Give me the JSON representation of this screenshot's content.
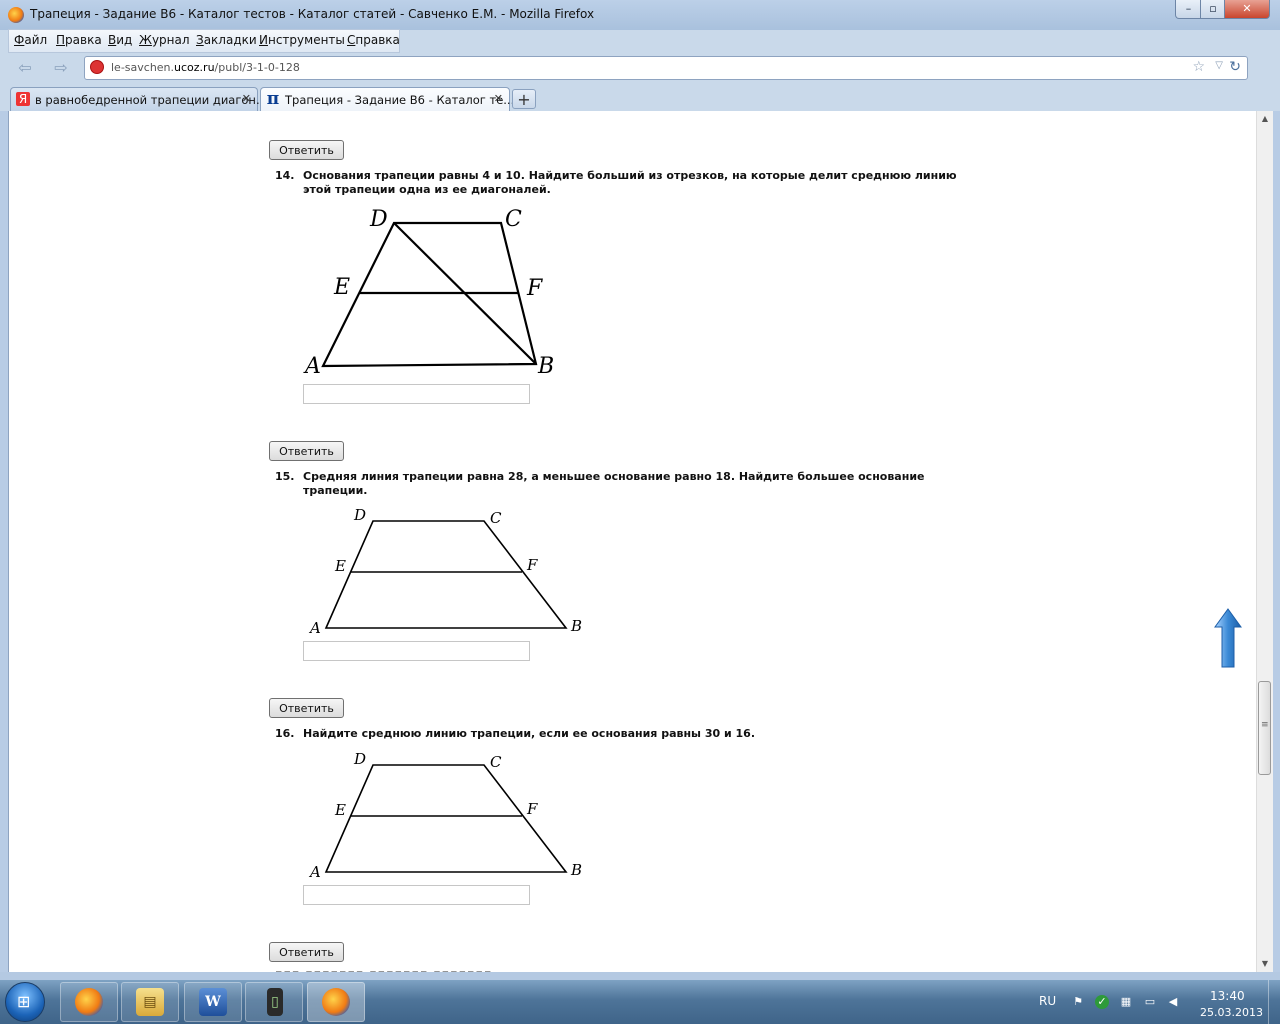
{
  "window": {
    "title": "Трапеция - Задание B6 - Каталог тестов - Каталог статей - Савченко Е.М. - Mozilla Firefox",
    "btn_min": "–",
    "btn_max": "▫",
    "btn_close": "✕"
  },
  "menu": [
    {
      "label": "Файл"
    },
    {
      "label": "Правка"
    },
    {
      "label": "Вид"
    },
    {
      "label": "Журнал"
    },
    {
      "label": "Закладки"
    },
    {
      "label": "Инструменты"
    },
    {
      "label": "Справка"
    }
  ],
  "nav": {
    "back": "⇦",
    "forward": "⇨",
    "url_host": "le-savchen.",
    "url_domain": "ucoz.ru",
    "url_path": "/publ/3-1-0-128",
    "star": "☆",
    "dropdown": "▽",
    "reload": "↻"
  },
  "tabs": [
    {
      "icon": "Я",
      "label": "в равнобедренной трапеции диагон...",
      "close": "✕",
      "active": false
    },
    {
      "icon": "π",
      "label": "Трапеция - Задание B6 - Каталог те...",
      "close": "✕",
      "active": true
    }
  ],
  "new_tab": "+",
  "answer_button_label": "Ответить",
  "questions": [
    {
      "number": "14.",
      "text": "Основания трапеции равны 4 и 10. Найдите больший из отрезков, на которые делит среднюю линию этой трапеции одна из ее диагоналей.",
      "labels": {
        "A": "A",
        "B": "B",
        "C": "C",
        "D": "D",
        "E": "E",
        "F": "F"
      }
    },
    {
      "number": "15.",
      "text": "Средняя линия трапеции равна 28, а меньшее основание равно 18. Найдите большее основание трапеции.",
      "labels": {
        "A": "A",
        "B": "B",
        "C": "C",
        "D": "D",
        "E": "E",
        "F": "F"
      }
    },
    {
      "number": "16.",
      "text": "Найдите среднюю линию трапеции, если ее основания равны 30 и 16.",
      "labels": {
        "A": "A",
        "B": "B",
        "C": "C",
        "D": "D",
        "E": "E",
        "F": "F"
      }
    }
  ],
  "scroll": {
    "up": "▲",
    "down": "▼"
  },
  "taskbar": {
    "start_glyph": "⊞",
    "apps": [
      {
        "name": "Firefox",
        "glyph": "●"
      },
      {
        "name": "Explorer",
        "glyph": "▤"
      },
      {
        "name": "Word",
        "glyph": "W"
      },
      {
        "name": "Phone",
        "glyph": "▯"
      },
      {
        "name": "Firefox",
        "glyph": "●"
      }
    ],
    "lang": "RU",
    "time": "13:40",
    "date": "25.03.2013"
  },
  "colors": {
    "accent": "#3b8ad6",
    "arrow": "#3b8ad6"
  }
}
